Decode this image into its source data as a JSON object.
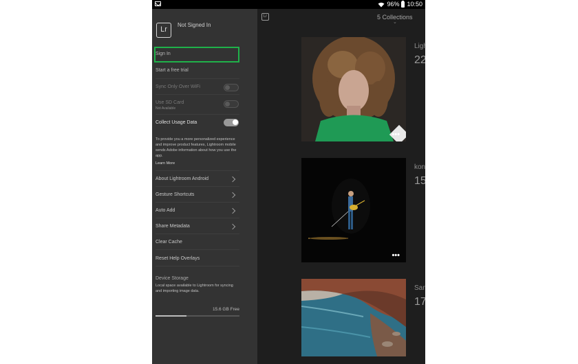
{
  "status_bar": {
    "battery": "96%",
    "time": "10:50",
    "icons": [
      "mail-icon",
      "wifi-icon",
      "battery-icon"
    ]
  },
  "app": {
    "logo_text": "Lr",
    "account_status": "Not Signed In",
    "mini_logo": "Lr"
  },
  "drawer": {
    "sign_in": "Sign In",
    "free_trial": "Start a free trial",
    "sync_wifi": {
      "label": "Sync Only Over WiFi",
      "enabled": false,
      "on": false
    },
    "sd_card": {
      "label": "Use SD Card",
      "sublabel": "Not Available",
      "enabled": false,
      "on": false
    },
    "usage_data": {
      "label": "Collect Usage Data",
      "on": true
    },
    "privacy_text": "To provide you a more personalized experience and improve product features, Lightroom mobile sends Adobe information about how you use the app.",
    "learn_more": "Learn More",
    "menu": [
      {
        "label": "About Lightroom Android",
        "has_chevron": true
      },
      {
        "label": "Gesture Shortcuts",
        "has_chevron": true
      },
      {
        "label": "Auto Add",
        "has_chevron": true
      },
      {
        "label": "Share Metadata",
        "has_chevron": true
      },
      {
        "label": "Clear Cache",
        "has_chevron": false
      },
      {
        "label": "Reset Help Overlays",
        "has_chevron": false
      }
    ],
    "storage": {
      "title": "Device Storage",
      "description": "Local space available to Lightroom for syncing and importing image data.",
      "free": "15.6 GB Free",
      "used_fraction": 0.37
    }
  },
  "content": {
    "collections_label": "5 Collections",
    "albums": [
      {
        "name": "Ligh",
        "count": "22"
      },
      {
        "name": "kon",
        "count": "15"
      },
      {
        "name": "San",
        "count": "17"
      }
    ],
    "more_glyph": "•••"
  },
  "colors": {
    "accent_highlight": "#1fb24a",
    "drawer_bg": "#333333",
    "content_bg": "#1e1e1e"
  }
}
